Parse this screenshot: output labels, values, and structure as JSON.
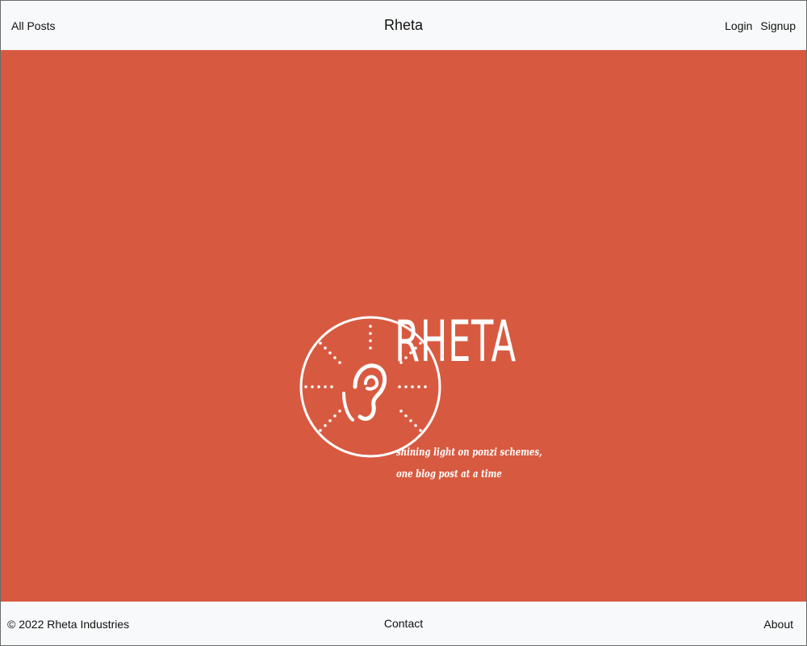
{
  "navbar": {
    "left_link": "All Posts",
    "brand": "Rheta",
    "login": "Login",
    "signup": "Signup"
  },
  "hero": {
    "background_color": "#d75a40",
    "logo": {
      "wordmark": "RHETA",
      "tagline_line1": "shining light on ponzi schemes,",
      "tagline_line2": "one blog post at a time",
      "icon": "sun-ear-icon"
    }
  },
  "footer": {
    "copyright": "© 2022 Rheta Industries",
    "contact": "Contact",
    "about": "About"
  }
}
